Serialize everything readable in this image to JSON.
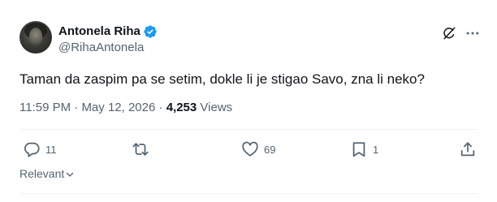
{
  "author": {
    "display_name": "Antonela Riha",
    "handle": "@RihaAntonela",
    "verified": true
  },
  "tweet": {
    "text": "Taman da zaspim pa se setim, dokle li je stigao Savo, zna li neko?",
    "time": "11:59 PM",
    "separator": "·",
    "date": "May 12, 2026",
    "views_count": "4,253",
    "views_label": "Views"
  },
  "actions": {
    "replies": "11",
    "likes": "69",
    "bookmarks": "1"
  },
  "sort": {
    "label": "Relevant"
  },
  "colors": {
    "verified_badge": "#1d9bf0",
    "muted_text": "#536471",
    "primary_text": "#0f1419"
  },
  "icons": [
    "verified-badge-icon",
    "grok-icon",
    "more-icon",
    "reply-icon",
    "retweet-icon",
    "like-icon",
    "bookmark-icon",
    "share-icon",
    "chevron-down-icon"
  ]
}
